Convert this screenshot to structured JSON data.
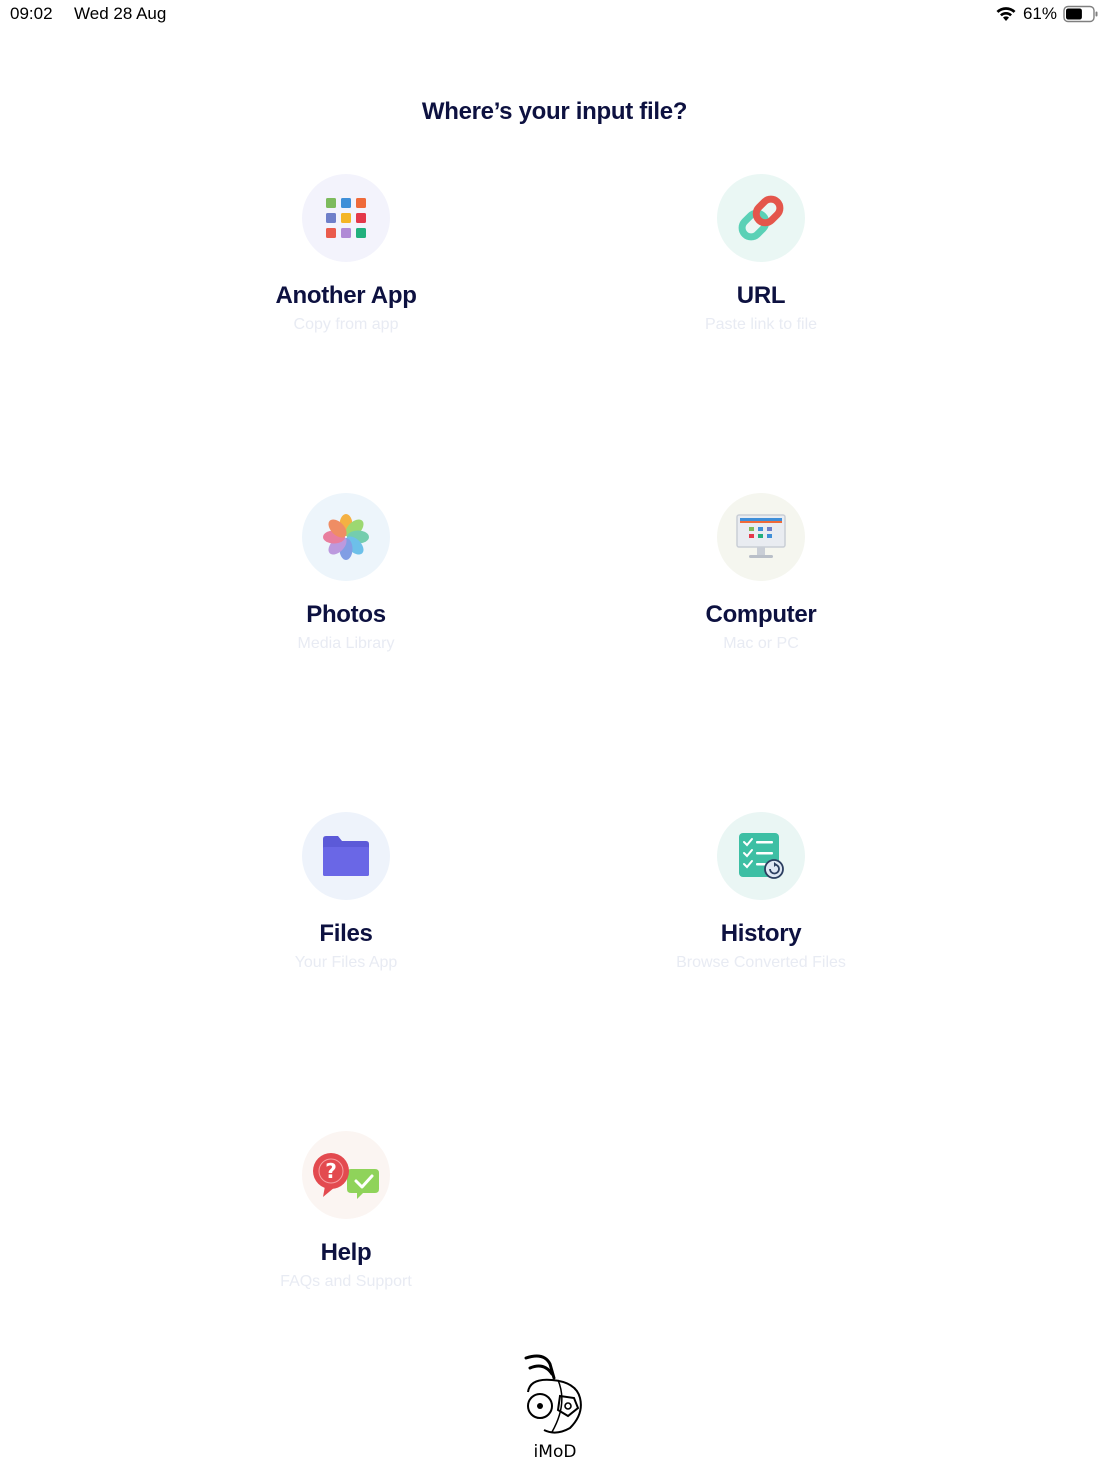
{
  "status_bar": {
    "time": "09:02",
    "date": "Wed 28 Aug",
    "battery": "61%",
    "battery_level": 0.61,
    "icons": [
      "wifi-icon",
      "battery-icon"
    ]
  },
  "title": "Where’s your input file?",
  "options": [
    {
      "id": "another-app",
      "label": "Another App",
      "subtitle": "Copy from app",
      "icon": "app-grid-icon"
    },
    {
      "id": "url",
      "label": "URL",
      "subtitle": "Paste link to file",
      "icon": "link-icon"
    },
    {
      "id": "photos",
      "label": "Photos",
      "subtitle": "Media Library",
      "icon": "photos-flower-icon"
    },
    {
      "id": "computer",
      "label": "Computer",
      "subtitle": "Mac or PC",
      "icon": "computer-monitor-icon"
    },
    {
      "id": "files",
      "label": "Files",
      "subtitle": "Your Files App",
      "icon": "folder-icon"
    },
    {
      "id": "history",
      "label": "History",
      "subtitle": "Browse Converted Files",
      "icon": "checklist-history-icon"
    },
    {
      "id": "help",
      "label": "Help",
      "subtitle": "FAQs and Support",
      "icon": "help-chat-icon"
    }
  ],
  "watermark": {
    "text": "iMoD",
    "icon": "imod-mascot-logo"
  },
  "colors": {
    "title": "#0d1140",
    "subtitle": "#e8ebf3",
    "folder": "#6a67e6",
    "link_red": "#e4564b",
    "link_teal": "#5ad1b6",
    "history_teal": "#3dbfa4",
    "help_red": "#e34a4f",
    "help_green": "#8fd35a"
  }
}
